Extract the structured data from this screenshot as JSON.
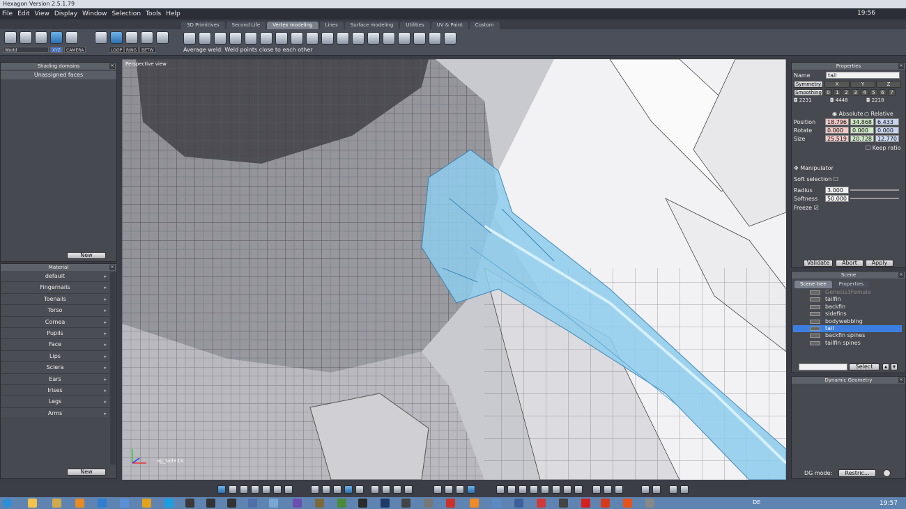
{
  "window": {
    "title": "Hexagon Version 2.5.1.79",
    "clock": "19:56"
  },
  "menu": [
    "File",
    "Edit",
    "View",
    "Display",
    "Window",
    "Selection",
    "Tools",
    "Help"
  ],
  "tabs": [
    "3D Primitives",
    "Second Life",
    "Vertex modeling",
    "Lines",
    "Surface modeling",
    "Utilities",
    "UV & Paint",
    "Custom"
  ],
  "active_tab": "Vertex modeling",
  "toolbar": {
    "coord_select": "World",
    "xyz_label": "XYZ",
    "camera_label": "CAMERA",
    "loop": "LOOP",
    "ring": "RING",
    "betw": "BETW",
    "hint": "Average weld: Weld points close to each other"
  },
  "shading": {
    "title": "Shading domains",
    "item": "Unassigned faces",
    "new": "New"
  },
  "material": {
    "title": "Material",
    "items": [
      "default",
      "Fingernails",
      "Toenails",
      "Torso",
      "Cornea",
      "Pupils",
      "Face",
      "Lips",
      "Sclera",
      "Ears",
      "Irises",
      "Legs",
      "Arms"
    ],
    "new": "New"
  },
  "viewport": {
    "label": "Perspective view",
    "object_label": "ag_tail+1X"
  },
  "properties": {
    "title": "Properties",
    "name_label": "Name",
    "name_value": "tail",
    "symmetry": "Symmetry",
    "axes": [
      "X",
      "Y",
      "Z"
    ],
    "smoothing": "Smoothing",
    "smooth_levels": [
      "0",
      "1",
      "2",
      "3",
      "4",
      "5",
      "6",
      "7"
    ],
    "counts": [
      "2231",
      "4448",
      "2218"
    ],
    "absolute": "Absolute",
    "relative": "Relative",
    "position_label": "Position",
    "position": [
      "18.796",
      "34.868",
      "6.433"
    ],
    "rotate_label": "Rotate",
    "rotate": [
      "0.000",
      "0.000",
      "0.000"
    ],
    "size_label": "Size",
    "size": [
      "25.519",
      "20.728",
      "12.770"
    ],
    "keep_ratio": "Keep ratio",
    "manipulator": "Manipulator",
    "soft_selection": "Soft selection",
    "radius_label": "Radius",
    "radius": "3.000",
    "softness_label": "Softness",
    "softness": "50.000",
    "freeze": "Freeze",
    "validate": "Validate",
    "abort": "Abort",
    "apply": "Apply"
  },
  "scene": {
    "title": "Scene",
    "tab_tree": "Scene tree",
    "tab_props": "Properties",
    "items": [
      "Genesis3Female",
      "tailfin",
      "backfin",
      "sidefins",
      "bodywebbing",
      "tail",
      "backfin spines",
      "tailfin spines"
    ],
    "selected": "tail",
    "select_btn": "Select"
  },
  "dynamic": {
    "title": "Dynamic Geometry",
    "dg_label": "DG mode:",
    "dg_value": "Restric..."
  },
  "taskbar": {
    "lang": "DE",
    "clock": "19:57"
  },
  "colors": {
    "accent": "#3d7fe0",
    "selection_mesh": "#7fc6ea"
  }
}
